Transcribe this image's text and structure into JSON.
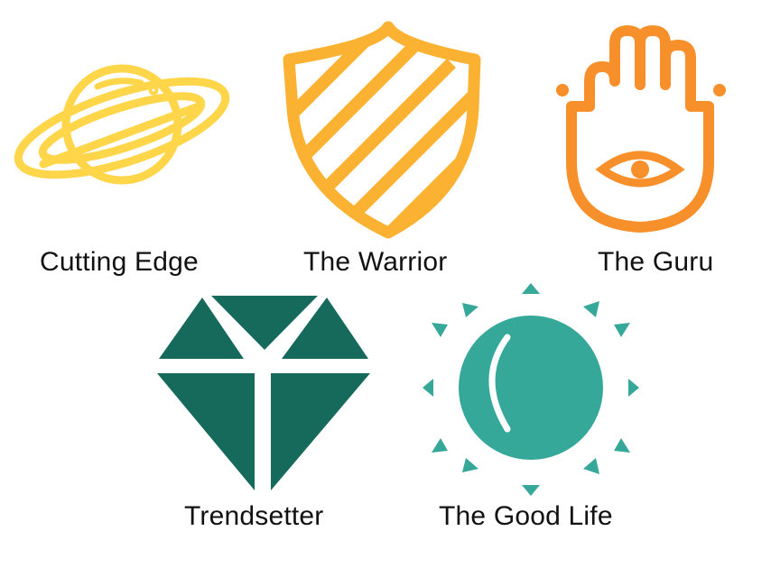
{
  "colors": {
    "cutting_edge": "#FFD54A",
    "warrior": "#FBB232",
    "guru": "#F7902B",
    "trendsetter": "#166A5B",
    "good_life": "#35A89A",
    "label_text": "#111111",
    "background": "#FFFFFF"
  },
  "archetypes": [
    {
      "label": "Cutting Edge",
      "icon": "planet-ring-icon"
    },
    {
      "label": "The Warrior",
      "icon": "striped-shield-icon"
    },
    {
      "label": "The Guru",
      "icon": "hamsa-hand-eye-icon"
    },
    {
      "label": "Trendsetter",
      "icon": "diamond-gem-icon"
    },
    {
      "label": "The Good Life",
      "icon": "sun-icon"
    }
  ]
}
